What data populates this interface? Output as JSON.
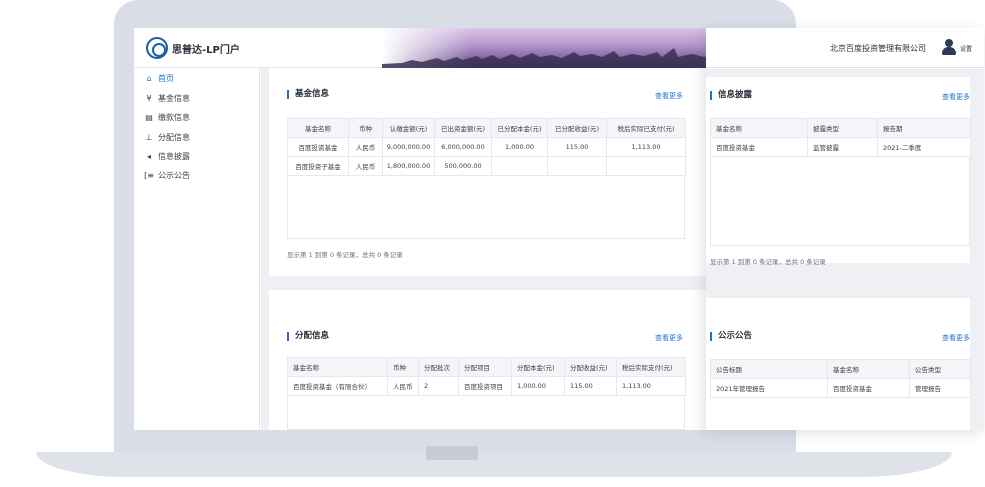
{
  "app": {
    "title": "思普达-LP门户"
  },
  "header": {
    "company": "北京百度投资管理有限公司",
    "settings": "设置"
  },
  "sidebar": {
    "items": [
      {
        "icon": "home-icon",
        "glyph": "⌂",
        "label": "首页",
        "active": true
      },
      {
        "icon": "yen-icon",
        "glyph": "¥",
        "label": "基金信息"
      },
      {
        "icon": "card-icon",
        "glyph": "▤",
        "label": "缴款信息"
      },
      {
        "icon": "sitemap-icon",
        "glyph": "⊥",
        "label": "分配信息"
      },
      {
        "icon": "speaker-icon",
        "glyph": "◂",
        "label": "信息披露"
      },
      {
        "icon": "announce-icon",
        "glyph": "[≡",
        "label": "公示公告"
      }
    ]
  },
  "fund_panel": {
    "title": "基金信息",
    "more": "查看更多",
    "columns": [
      "基金名称",
      "币种",
      "认缴金额(元)",
      "已出资金额(元)",
      "已分配本金(元)",
      "已分配收益(元)",
      "税后实际已支付(元)"
    ],
    "rows": [
      [
        "百度投资基金",
        "人民币",
        "9,000,000.00",
        "6,000,000.00",
        "1,000.00",
        "115.00",
        "1,113.00"
      ],
      [
        "百度投资子基金",
        "人民币",
        "1,800,000.00",
        "500,000.00",
        "",
        "",
        ""
      ]
    ],
    "pager": "显示第 1 到第 0 条记录，总共 0 条记录"
  },
  "dist_panel": {
    "title": "分配信息",
    "more": "查看更多",
    "columns": [
      "基金名称",
      "币种",
      "分配批次",
      "分配项目",
      "分配本金(元)",
      "分配收益(元)",
      "税后实际支付(元)"
    ],
    "rows": [
      [
        "百度投资基金（有限合伙）",
        "人民币",
        "2",
        "百度投资项目",
        "1,000.00",
        "115.00",
        "1,113.00"
      ]
    ]
  },
  "disclosure_panel": {
    "title": "信息披露",
    "more": "查看更多",
    "columns": [
      "基金名称",
      "披露类型",
      "报告期"
    ],
    "rows": [
      [
        "百度投资基金",
        "监管披露",
        "2021-二季度"
      ]
    ],
    "pager": "显示第 1 到第 0 条记录，总共 0 条记录"
  },
  "notice_panel": {
    "title": "公示公告",
    "more": "查看更多",
    "columns": [
      "公告标题",
      "基金名称",
      "公告类型"
    ],
    "rows": [
      [
        "2021年管理报告",
        "百度投资基金",
        "管理报告"
      ]
    ]
  },
  "colors": {
    "accent": "#1e73d0",
    "frame": "#d9dde6",
    "page_bg": "#eef0f4"
  }
}
